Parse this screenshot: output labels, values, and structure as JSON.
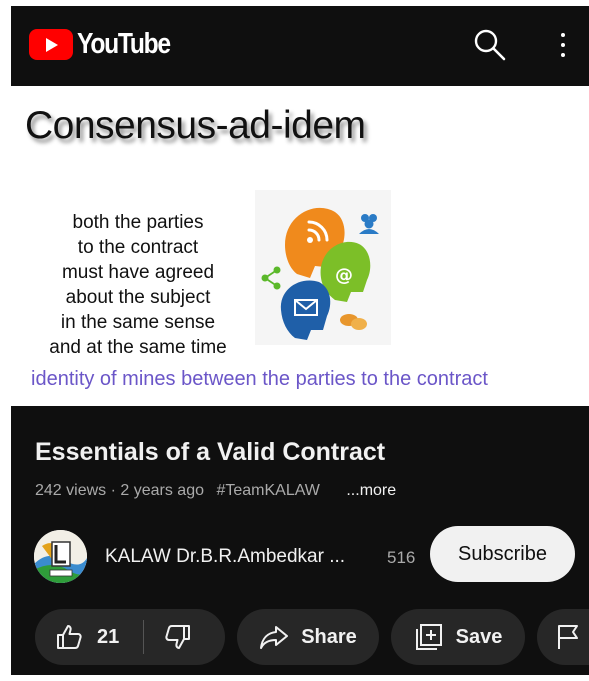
{
  "header": {
    "logo_text": "YouTube",
    "icons": [
      "youtube-logo-icon",
      "search-icon",
      "more-vert-icon"
    ]
  },
  "player": {
    "slide_title": "Consensus-ad-idem",
    "slide_body": "both the parties\nto the contract\nmust have agreed\nabout the subject\nin the same sense\nand at the same time",
    "slide_footer": "identity of mines between the parties to the contract"
  },
  "video": {
    "title": "Essentials of a Valid Contract",
    "views": "242 views",
    "separator": "·",
    "age": "2 years ago",
    "hashtag": "#TeamKALAW",
    "more": "...more"
  },
  "channel": {
    "name": "KALAW Dr.B.R.Ambedkar ...",
    "subscribers": "516",
    "subscribe_label": "Subscribe"
  },
  "actions": {
    "like_count": "21",
    "share_label": "Share",
    "save_label": "Save"
  },
  "colors": {
    "background": "#0f0f0f",
    "youtube_red": "#ff0000",
    "pill": "#272727",
    "footer_text": "#6b56c8"
  }
}
